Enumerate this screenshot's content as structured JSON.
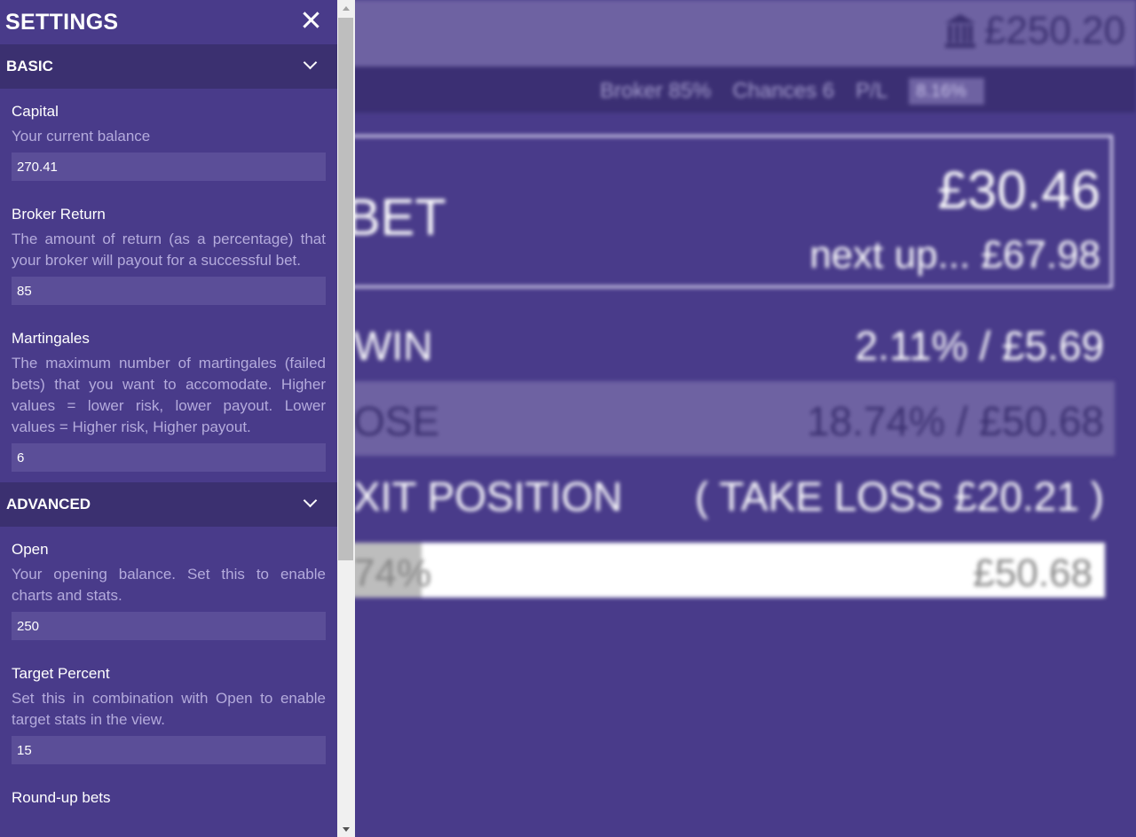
{
  "app": {
    "balance": "£250.20",
    "icon": "bank-icon",
    "stats": {
      "broker": "Broker 85%",
      "chances": "Chances 6",
      "pl_label": "P/L",
      "pl_value": "8.16%"
    },
    "bet": {
      "label": "BET",
      "amount": "£30.46",
      "next": "next up... £67.98"
    },
    "win": {
      "label": "WIN",
      "value": "2.11% / £5.69"
    },
    "lose": {
      "label": "OSE",
      "value": "18.74% / £50.68"
    },
    "exit": {
      "label": "XIT POSITION",
      "value": "( TAKE LOSS £20.21 )"
    },
    "progress": {
      "percent_label": "74%",
      "fraction": 0.12,
      "amount": "£50.68"
    }
  },
  "settings": {
    "title": "SETTINGS",
    "close_icon": "close-icon",
    "sections": {
      "basic": {
        "title": "BASIC",
        "fields": {
          "capital": {
            "label": "Capital",
            "desc": "Your current balance",
            "value": "270.41"
          },
          "broker_return": {
            "label": "Broker Return",
            "desc": "The amount of return (as a percentage) that your broker will payout for a successful bet.",
            "value": "85"
          },
          "martingales": {
            "label": "Martingales",
            "desc": "The maximum number of martingales (failed bets) that you want to accomodate. Higher values = lower risk, lower payout. Lower values = Higher risk, Higher payout.",
            "value": "6"
          }
        }
      },
      "advanced": {
        "title": "ADVANCED",
        "fields": {
          "open": {
            "label": "Open",
            "desc": "Your opening balance. Set this to enable charts and stats.",
            "value": "250"
          },
          "target_percent": {
            "label": "Target Percent",
            "desc": "Set this in combination with Open to enable target stats in the view.",
            "value": "15"
          },
          "round_up": {
            "label": "Round-up bets"
          }
        }
      }
    }
  }
}
